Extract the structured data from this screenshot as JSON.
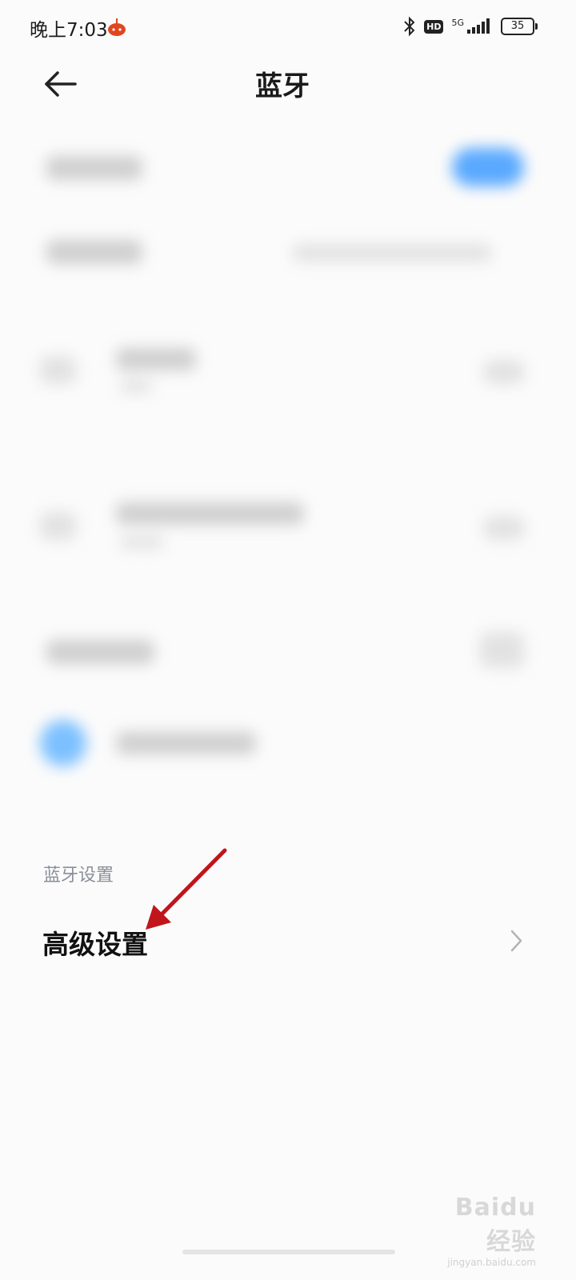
{
  "status_bar": {
    "time": "晚上7:03",
    "hd": "HD",
    "network": "5G",
    "battery": "35",
    "icons": [
      "app-notification-icon",
      "bluetooth-icon",
      "hd-icon",
      "signal-icon",
      "battery-icon"
    ]
  },
  "nav": {
    "title": "蓝牙",
    "back_icon": "back-arrow-icon"
  },
  "settings": {
    "section_label": "蓝牙设置",
    "advanced_label": "高级设置",
    "chevron_icon": "chevron-right-icon"
  },
  "watermark": {
    "main": "Baidu经验",
    "sub": "jingyan.baidu.com"
  },
  "colors": {
    "accent_blue": "#5aa9ff",
    "annotation_red": "#c0151b",
    "section_gray": "#8a8f99"
  }
}
